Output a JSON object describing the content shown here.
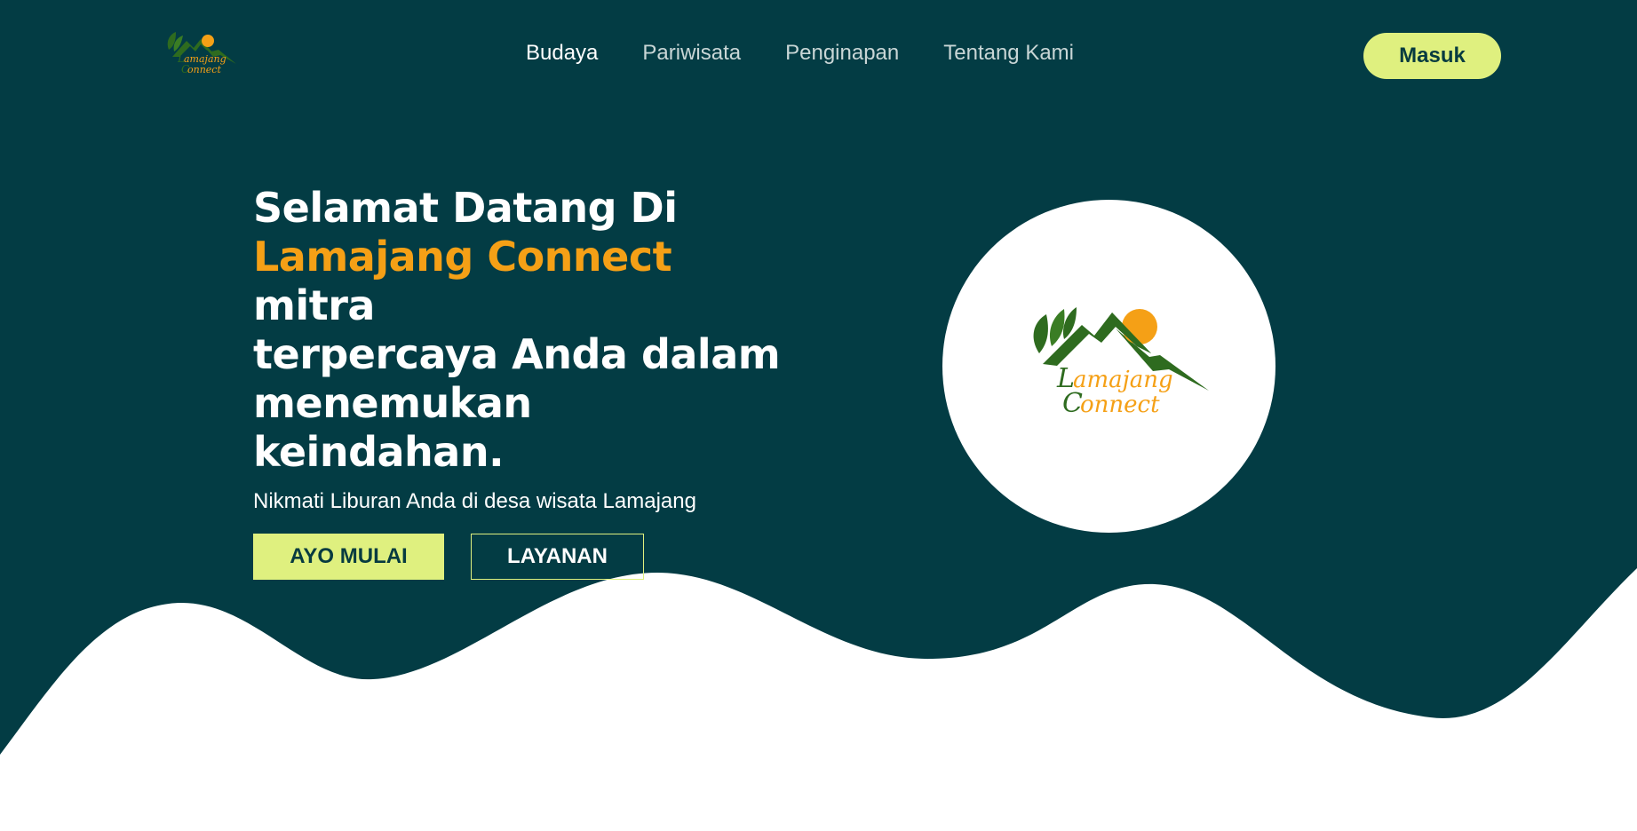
{
  "colors": {
    "hero_bg": "#033c44",
    "accent": "#f5a016",
    "button_bg": "#dff07f",
    "button_text": "#073b40",
    "logo_green": "#2e6b1f"
  },
  "brand": {
    "logo_line1": "amajang",
    "logo_line2": "onnect",
    "logo_initial1": "L",
    "logo_initial2": "C"
  },
  "nav": {
    "items": [
      {
        "label": "Budaya",
        "active": true
      },
      {
        "label": "Pariwisata",
        "active": false
      },
      {
        "label": "Penginapan",
        "active": false
      },
      {
        "label": "Tentang Kami",
        "active": false
      }
    ],
    "login_label": "Masuk"
  },
  "hero": {
    "headline_part1": "Selamat Datang Di",
    "headline_accent": "Lamajang Connect",
    "headline_part2": " mitra",
    "headline_line3": "terpercaya Anda dalam",
    "headline_line4": "menemukan keindahan.",
    "subtitle": "Nikmati Liburan Anda di desa wisata Lamajang",
    "primary_button": "AYO MULAI",
    "secondary_button": "LAYANAN"
  }
}
